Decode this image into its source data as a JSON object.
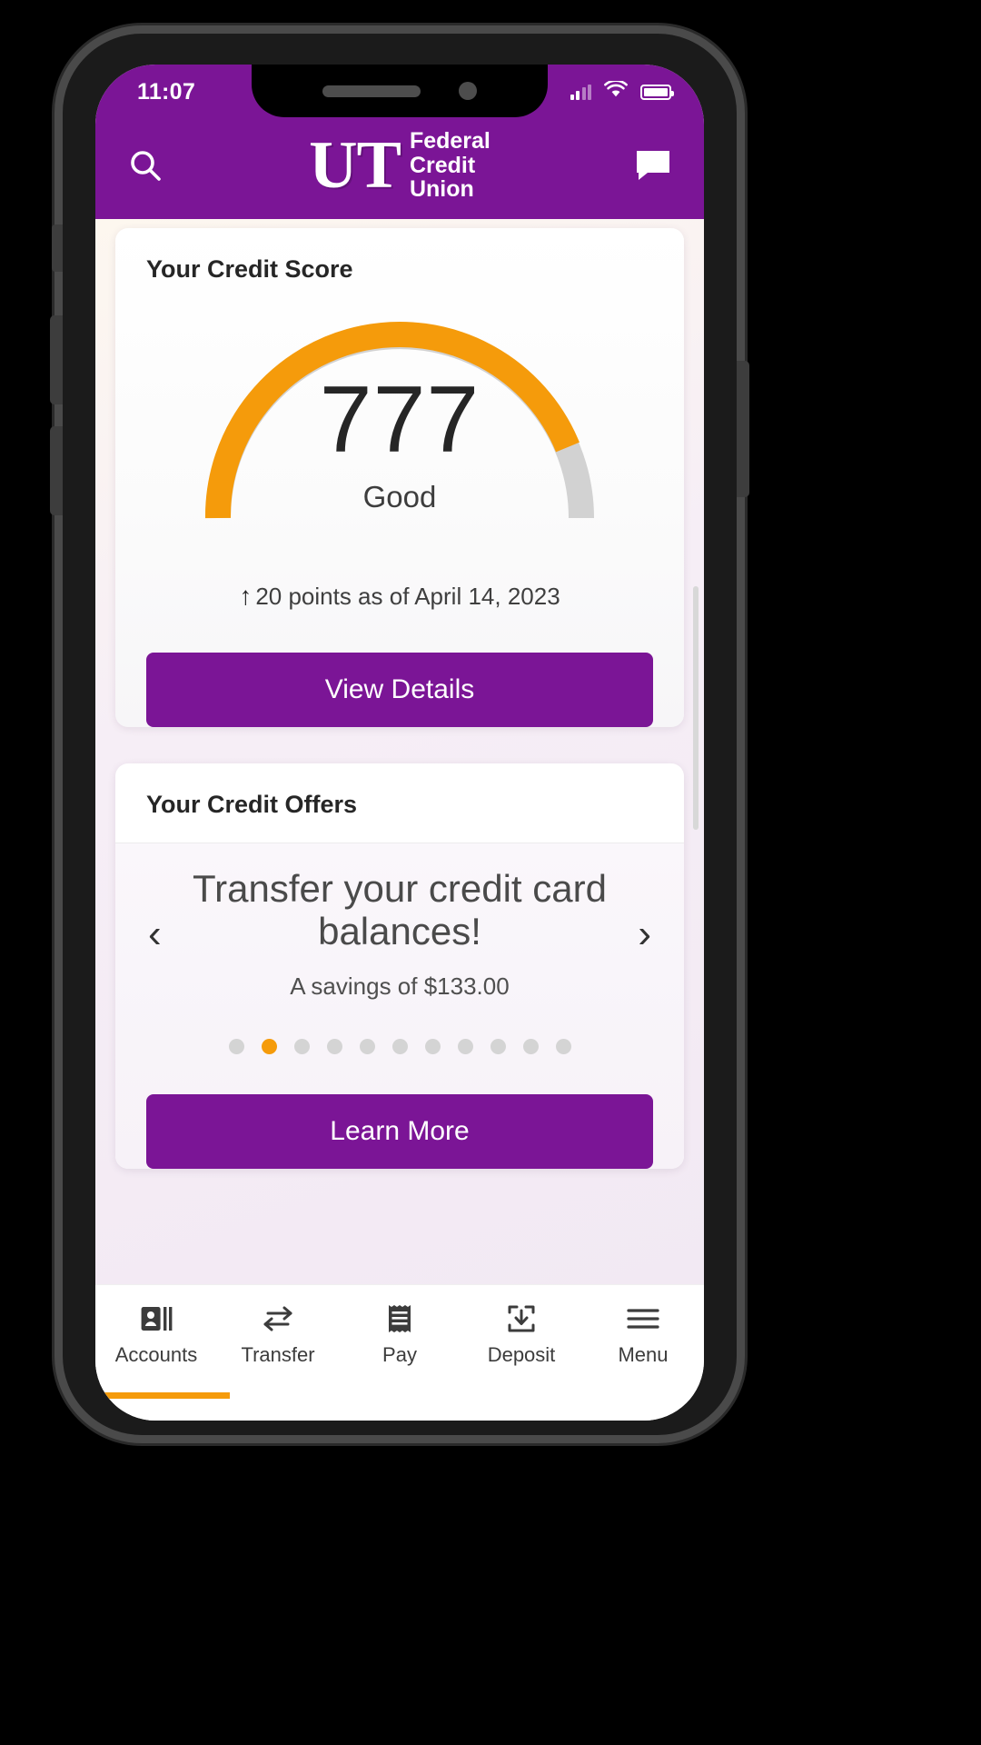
{
  "status_bar": {
    "time": "11:07",
    "signal_icon": "cellular-signal-icon",
    "wifi_icon": "wifi-icon",
    "battery_icon": "battery-full-icon"
  },
  "app_bar": {
    "search_icon": "search-icon",
    "message_icon": "chat-message-icon",
    "logo_mark": "UT",
    "logo_line1": "Federal",
    "logo_line2": "Credit",
    "logo_line3": "Union"
  },
  "credit_score_card": {
    "title": "Your Credit Score",
    "score": "777",
    "rating": "Good",
    "delta_arrow": "↑",
    "delta_text": "20 points as of April 14, 2023",
    "cta_label": "View Details",
    "gauge_arc_color": "#F59B0B",
    "gauge_track_color": "#D2D2D2"
  },
  "credit_offers_card": {
    "title": "Your Credit Offers",
    "prev_icon": "chevron-left-icon",
    "next_icon": "chevron-right-icon",
    "headline": "Transfer your credit card balances!",
    "subtext": "A savings of $133.00",
    "cta_label": "Learn More",
    "dots_total": 11,
    "dots_active_index": 1,
    "dot_active_color": "#F59B0B",
    "dot_inactive_color": "#D4D4D4"
  },
  "tabbar": {
    "active_index": 0,
    "accent_color": "#F59B0B",
    "items": [
      {
        "label": "Accounts",
        "icon": "accounts-id-card-icon"
      },
      {
        "label": "Transfer",
        "icon": "transfer-arrows-icon"
      },
      {
        "label": "Pay",
        "icon": "pay-receipt-icon"
      },
      {
        "label": "Deposit",
        "icon": "deposit-download-box-icon"
      },
      {
        "label": "Menu",
        "icon": "hamburger-menu-icon"
      }
    ]
  },
  "theme": {
    "brand_purple": "#7B1596",
    "accent_orange": "#F59B0B"
  },
  "chart_data": {
    "type": "gauge",
    "title": "Your Credit Score",
    "value": 777,
    "value_label": "777",
    "rating": "Good",
    "range": [
      300,
      850
    ],
    "sweep_degrees": 180,
    "filled_fraction": 0.87,
    "filled_color": "#F59B0B",
    "track_color": "#D2D2D2",
    "annotation": "↑ 20 points as of April 14, 2023"
  }
}
